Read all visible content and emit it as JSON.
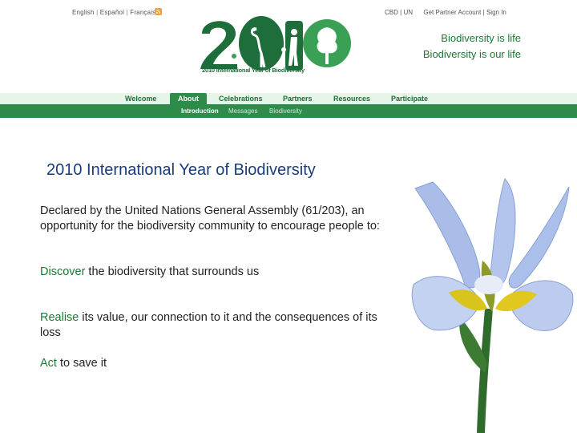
{
  "top_links": {
    "english": "English",
    "espanol": "Español",
    "francais": "Français"
  },
  "account_links": {
    "cbd": "CBD",
    "un": "UN",
    "partner": "Get Partner Account",
    "signin": "Sign In"
  },
  "logo": {
    "caption": "2010 International Year of Biodiversity"
  },
  "tagline": {
    "line1": "Biodiversity is life",
    "line2": "Biodiversity is our life"
  },
  "nav": {
    "tabs": [
      {
        "label": "Welcome"
      },
      {
        "label": "About"
      },
      {
        "label": "Celebrations"
      },
      {
        "label": "Partners"
      },
      {
        "label": "Resources"
      },
      {
        "label": "Participate"
      }
    ],
    "subtabs": [
      {
        "label": "Introduction"
      },
      {
        "label": "Messages"
      },
      {
        "label": "Biodiversity"
      }
    ]
  },
  "main": {
    "title": "2010 International Year of Biodiversity",
    "intro": "Declared by the United Nations General Assembly (61/203), an opportunity for the biodiversity community to encourage people to:",
    "items": [
      {
        "keyword": "Discover",
        "rest": " the biodiversity that surrounds us"
      },
      {
        "keyword": "Realise",
        "rest": " its value, our connection to it and the consequences of its loss"
      },
      {
        "keyword": "Act",
        "rest": " to save it"
      }
    ]
  },
  "colors": {
    "brand_green": "#1a7a34",
    "nav_green": "#2e8b4a",
    "nav_light": "#e6f4ea",
    "title_blue": "#1a3c7a"
  }
}
